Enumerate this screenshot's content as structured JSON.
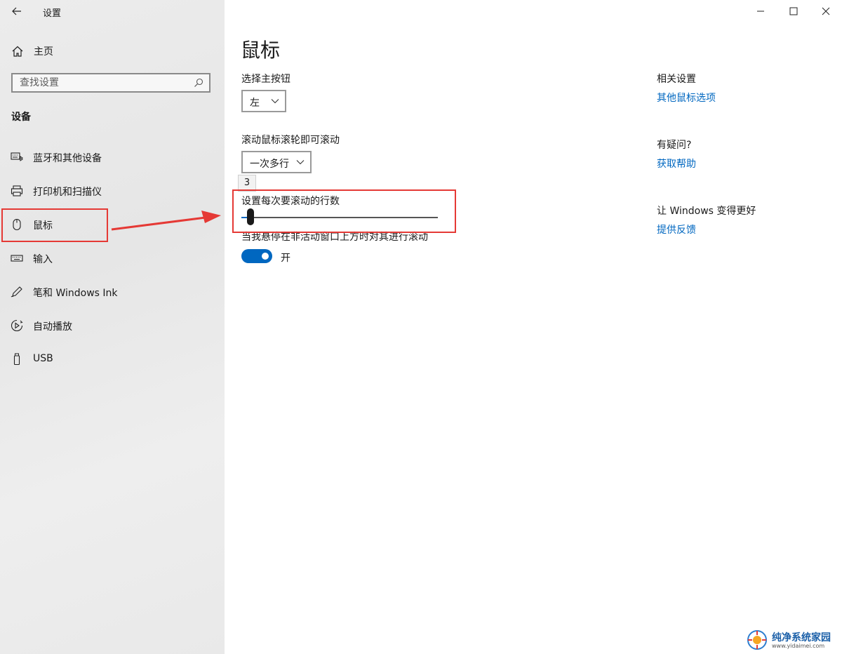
{
  "window": {
    "title": "设置"
  },
  "sidebar": {
    "home_label": "主页",
    "search_placeholder": "查找设置",
    "section_heading": "设备",
    "items": [
      {
        "label": "蓝牙和其他设备",
        "icon": "bluetooth-keyboard-icon"
      },
      {
        "label": "打印机和扫描仪",
        "icon": "printer-icon"
      },
      {
        "label": "鼠标",
        "icon": "mouse-icon"
      },
      {
        "label": "输入",
        "icon": "keyboard-icon"
      },
      {
        "label": "笔和 Windows Ink",
        "icon": "pen-icon"
      },
      {
        "label": "自动播放",
        "icon": "autoplay-icon"
      },
      {
        "label": "USB",
        "icon": "usb-icon"
      }
    ]
  },
  "main": {
    "page_title": "鼠标",
    "primary_button": {
      "label": "选择主按钮",
      "value": "左"
    },
    "scroll_mode": {
      "label": "滚动鼠标滚轮即可滚动",
      "value": "一次多行"
    },
    "lines_slider": {
      "label": "设置每次要滚动的行数",
      "value": "3",
      "fraction": 0.03
    },
    "inactive_scroll": {
      "label": "当我悬停在非活动窗口上方时对其进行滚动",
      "state": "开"
    }
  },
  "related": {
    "heading": "相关设置",
    "link": "其他鼠标选项",
    "question_heading": "有疑问?",
    "help_link": "获取帮助",
    "feedback_heading": "让 Windows 变得更好",
    "feedback_link": "提供反馈"
  },
  "watermark": {
    "title": "纯净系统家园",
    "url": "www.yidaimei.com"
  },
  "colors": {
    "accent": "#0067c0",
    "highlight": "#e53935"
  }
}
